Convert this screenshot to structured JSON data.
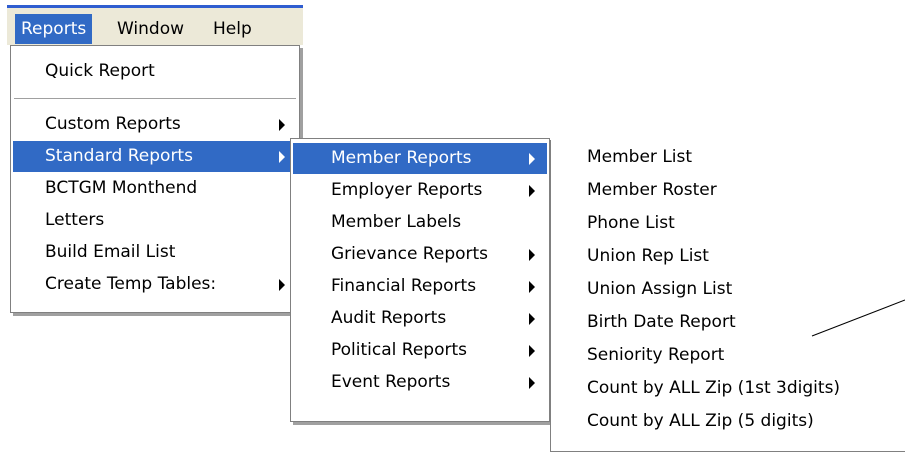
{
  "menubar": {
    "items": [
      {
        "label": "Reports"
      },
      {
        "label": "Window"
      },
      {
        "label": "Help"
      }
    ]
  },
  "reports_menu": {
    "items": [
      {
        "label": "Quick Report"
      },
      {
        "label": "Custom Reports"
      },
      {
        "label": "Standard Reports"
      },
      {
        "label": "BCTGM Monthend"
      },
      {
        "label": "Letters"
      },
      {
        "label": "Build Email List"
      },
      {
        "label": "Create Temp Tables:"
      }
    ]
  },
  "standard_reports_menu": {
    "items": [
      {
        "label": "Member Reports"
      },
      {
        "label": "Employer Reports"
      },
      {
        "label": "Member Labels"
      },
      {
        "label": "Grievance Reports"
      },
      {
        "label": "Financial Reports"
      },
      {
        "label": "Audit Reports"
      },
      {
        "label": "Political Reports"
      },
      {
        "label": "Event Reports"
      }
    ]
  },
  "member_reports_menu": {
    "items": [
      {
        "label": "Member List"
      },
      {
        "label": "Member Roster"
      },
      {
        "label": "Phone List"
      },
      {
        "label": "Union Rep List"
      },
      {
        "label": "Union Assign List"
      },
      {
        "label": "Birth Date Report"
      },
      {
        "label": "Seniority Report"
      },
      {
        "label": "Count by ALL Zip (1st 3digits)"
      },
      {
        "label": "Count by ALL Zip (5 digits)"
      }
    ]
  },
  "colors": {
    "highlight": "#316ac5",
    "menubar_bg": "#ece9d8",
    "title_accent": "#2f5dd0"
  }
}
